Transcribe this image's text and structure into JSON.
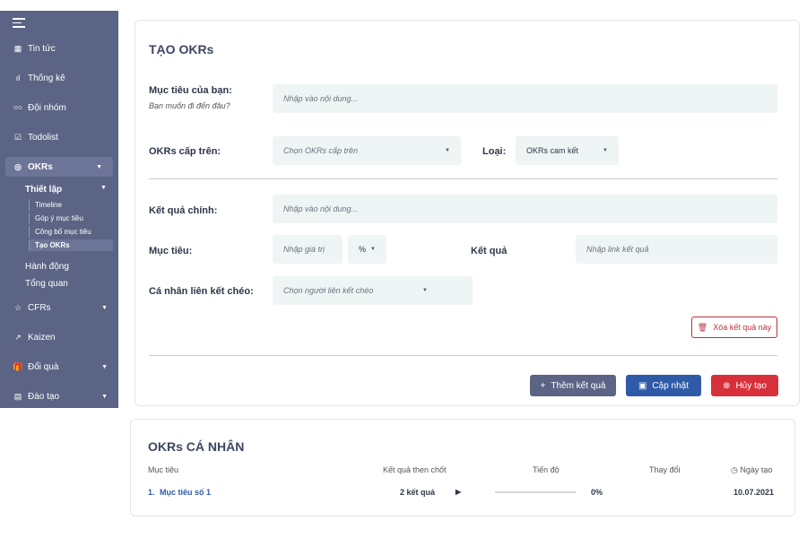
{
  "sidebar": {
    "items": [
      {
        "label": "Tin tức",
        "icon": "grid-icon"
      },
      {
        "label": "Thống kê",
        "icon": "bar-chart-icon"
      },
      {
        "label": "Đội nhóm",
        "icon": "team-icon"
      },
      {
        "label": "Todolist",
        "icon": "checkbox-icon"
      },
      {
        "label": "OKRs",
        "icon": "target-icon"
      },
      {
        "label": "CFRs",
        "icon": "star-icon"
      },
      {
        "label": "Kaizen",
        "icon": "trend-icon"
      },
      {
        "label": "Đổi quà",
        "icon": "gift-icon"
      },
      {
        "label": "Đào tạo",
        "icon": "book-icon"
      }
    ],
    "okrs_sub": {
      "setup_label": "Thiết lập",
      "setup_items": [
        "Timeline",
        "Góp ý mục tiêu",
        "Công bố mục tiêu",
        "Tạo OKRs"
      ],
      "action_label": "Hành động",
      "overview_label": "Tổng quan"
    }
  },
  "form": {
    "title": "TẠO OKRs",
    "objective_label": "Mục tiêu của bạn:",
    "objective_hint": "Bạn muốn đi đến đâu?",
    "objective_placeholder": "Nhập vào nội dung...",
    "parent_label": "OKRs cấp trên:",
    "parent_placeholder": "Chọn OKRs cấp trên",
    "type_label": "Loại:",
    "type_value": "OKRs cam kết",
    "key_result_label": "Kết quả chính:",
    "key_result_placeholder": "Nhập vào nội dung...",
    "target_label": "Mục tiêu:",
    "target_placeholder": "Nhập giá trị",
    "unit_value": "%",
    "result_label": "Kết quả",
    "result_placeholder": "Nhập link kết quả",
    "cross_label": "Cá nhân liên kết chéo:",
    "cross_placeholder": "Chọn người liên kết chéo",
    "delete_label": "Xóa kết quả này",
    "add_label": "Thêm kết quả",
    "update_label": "Cập nhật",
    "cancel_label": "Hủy tạo"
  },
  "personal": {
    "title": "OKRs CÁ NHÂN",
    "columns": [
      "Mục tiêu",
      "Kết quả then chốt",
      "Tiến độ",
      "Thay đổi",
      "Ngày tạo"
    ],
    "rows": [
      {
        "index": "1.",
        "objective": "Mục tiêu số 1",
        "key_results": "2 kết quả",
        "progress": "0%",
        "progress_value": 0,
        "date": "10.07.2021"
      }
    ]
  },
  "colors": {
    "sidebar": "#5b6484",
    "primary": "#2f5aa8",
    "danger": "#d8303b"
  }
}
